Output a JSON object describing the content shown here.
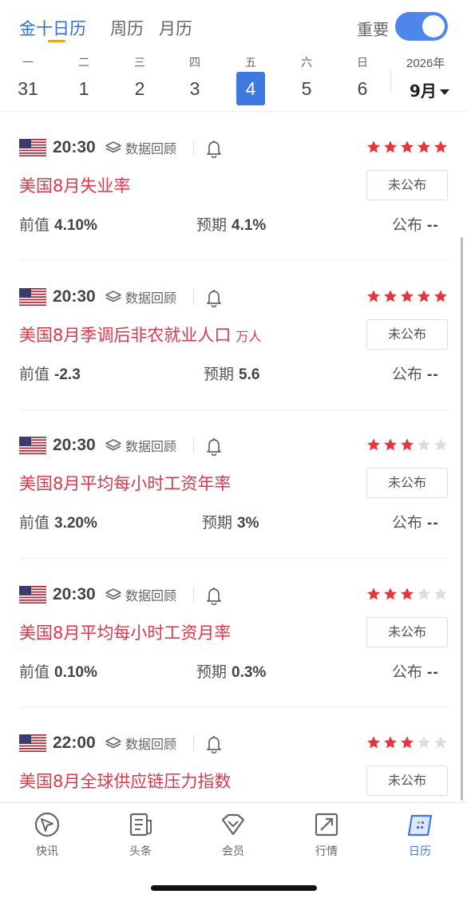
{
  "header": {
    "tabs": [
      {
        "label": "金十日历",
        "active": true
      },
      {
        "label": "周历",
        "active": false
      },
      {
        "label": "月历",
        "active": false
      }
    ],
    "important_label": "重要",
    "important_on": true
  },
  "week": {
    "days": [
      {
        "weekday": "一",
        "date": "31",
        "selected": false
      },
      {
        "weekday": "二",
        "date": "1",
        "selected": false
      },
      {
        "weekday": "三",
        "date": "2",
        "selected": false
      },
      {
        "weekday": "四",
        "date": "3",
        "selected": false
      },
      {
        "weekday": "五",
        "date": "4",
        "selected": true
      },
      {
        "weekday": "六",
        "date": "5",
        "selected": false
      },
      {
        "weekday": "日",
        "date": "6",
        "selected": false
      }
    ],
    "year": "2026年",
    "month": "9月"
  },
  "events": [
    {
      "country": "US",
      "time": "20:30",
      "review_label": "数据回顾",
      "stars": 5,
      "title": "美国8月失业率",
      "unit": "",
      "status": "未公布",
      "prev_label": "前值",
      "prev": "4.10%",
      "fore_label": "预期",
      "forecast": "4.1%",
      "pub_label": "公布",
      "actual": "--"
    },
    {
      "country": "US",
      "time": "20:30",
      "review_label": "数据回顾",
      "stars": 5,
      "title": "美国8月季调后非农就业人口",
      "unit": "万人",
      "status": "未公布",
      "prev_label": "前值",
      "prev": "-2.3",
      "fore_label": "预期",
      "forecast": "5.6",
      "pub_label": "公布",
      "actual": "--"
    },
    {
      "country": "US",
      "time": "20:30",
      "review_label": "数据回顾",
      "stars": 3,
      "title": "美国8月平均每小时工资年率",
      "unit": "",
      "status": "未公布",
      "prev_label": "前值",
      "prev": "3.20%",
      "fore_label": "预期",
      "forecast": "3%",
      "pub_label": "公布",
      "actual": "--"
    },
    {
      "country": "US",
      "time": "20:30",
      "review_label": "数据回顾",
      "stars": 3,
      "title": "美国8月平均每小时工资月率",
      "unit": "",
      "status": "未公布",
      "prev_label": "前值",
      "prev": "0.10%",
      "fore_label": "预期",
      "forecast": "0.3%",
      "pub_label": "公布",
      "actual": "--"
    },
    {
      "country": "US",
      "time": "22:00",
      "review_label": "数据回顾",
      "stars": 3,
      "title": "美国8月全球供应链压力指数",
      "unit": "",
      "status": "未公布",
      "prev_label": "",
      "prev": "",
      "fore_label": "",
      "forecast": "",
      "pub_label": "",
      "actual": ""
    }
  ],
  "nav": {
    "items": [
      {
        "label": "快讯",
        "icon": "flash-news-icon",
        "active": false
      },
      {
        "label": "头条",
        "icon": "headline-icon",
        "active": false
      },
      {
        "label": "会员",
        "icon": "vip-diamond-icon",
        "active": false
      },
      {
        "label": "行情",
        "icon": "market-chart-icon",
        "active": false
      },
      {
        "label": "日历",
        "icon": "calendar-icon",
        "active": true
      }
    ]
  },
  "colors": {
    "accent": "#3e79e0",
    "title_red": "#d9394b",
    "star_on": "#e8343d",
    "star_off": "#dddddd",
    "tab_underline": "#f0a020"
  }
}
